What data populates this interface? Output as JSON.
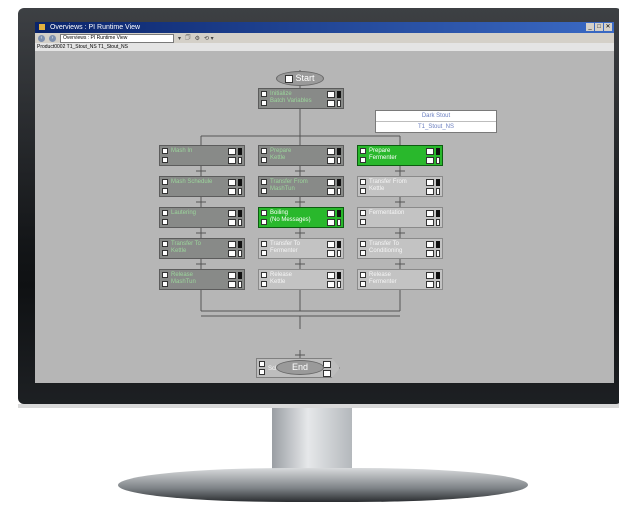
{
  "window": {
    "title": "Overviews : PI Runtime View",
    "buttons": [
      "_",
      "□",
      "✕"
    ]
  },
  "toolbar": {
    "back": "‹",
    "forward": "›",
    "address": "Overviews : PI Runtime View",
    "tools": [
      "▾",
      "🗇",
      "⚙",
      "⟲ ▾"
    ]
  },
  "breadcrumb": "Product0002   T1_Stout_NS   T1_Stout_NS",
  "info_box": {
    "product": "Dark Stout",
    "batch": "T1_Stout_NS"
  },
  "terminals": {
    "start": "Start",
    "end": "End"
  },
  "steps": [
    {
      "id": "initialize",
      "label": "Initialize\nBatch Variables",
      "state": "dark"
    },
    {
      "id": "mash-in",
      "label": "Mash In",
      "state": "dark"
    },
    {
      "id": "mash-schedule",
      "label": "Mash Schedule",
      "state": "dark"
    },
    {
      "id": "lautering",
      "label": "Lautering",
      "state": "dark"
    },
    {
      "id": "transfer-to-kettle",
      "label": "Transfer To\nKettle",
      "state": "dark"
    },
    {
      "id": "release-mashtun",
      "label": "Release\nMashTun",
      "state": "dark"
    },
    {
      "id": "prepare-kettle",
      "label": "Prepare\nKettle",
      "state": "dark"
    },
    {
      "id": "transfer-from-mashtun",
      "label": "Transfer From\nMashTun",
      "state": "dark"
    },
    {
      "id": "boiling",
      "label": "Boiling\n(No Messages)",
      "state": "active"
    },
    {
      "id": "transfer-to-fermenter",
      "label": "Transfer To\nFermenter",
      "state": "light"
    },
    {
      "id": "release-kettle",
      "label": "Release\nKettle",
      "state": "light"
    },
    {
      "id": "prepare-fermenter",
      "label": "Prepare\nFermenter",
      "state": "active"
    },
    {
      "id": "transfer-from-kettle",
      "label": "Transfer From\nKettle",
      "state": "light"
    },
    {
      "id": "fermentation",
      "label": "Fermentation",
      "state": "light"
    },
    {
      "id": "transfer-to-conditioning",
      "label": "Transfer To\nConditioning",
      "state": "light"
    },
    {
      "id": "release-fermenter",
      "label": "Release\nFermenter",
      "state": "light"
    }
  ],
  "schedule_job": {
    "label": "Schedule Job"
  }
}
